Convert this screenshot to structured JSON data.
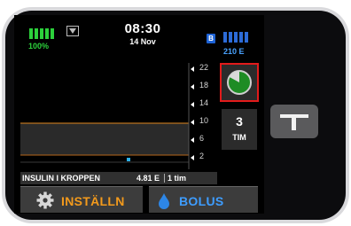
{
  "status": {
    "battery_percent": "100%",
    "time": "08:30",
    "date": "14 Nov",
    "bluetooth_label": "B",
    "insulin_units": "210 E"
  },
  "chart": {
    "scale_labels": [
      "22",
      "18",
      "14",
      "10",
      "6",
      "2"
    ],
    "time_range_value": "3",
    "time_range_unit": "TIM"
  },
  "iob": {
    "label": "INSULIN I KROPPEN",
    "value": "4.81 E",
    "duration": "1 tim"
  },
  "buttons": {
    "settings_label": "INSTÄLLN",
    "bolus_label": "BOLUS"
  },
  "colors": {
    "battery": "#2cd13b",
    "insulin": "#2c6bd8",
    "target_line": "#e0871e",
    "highlight": "#e21b1b"
  }
}
